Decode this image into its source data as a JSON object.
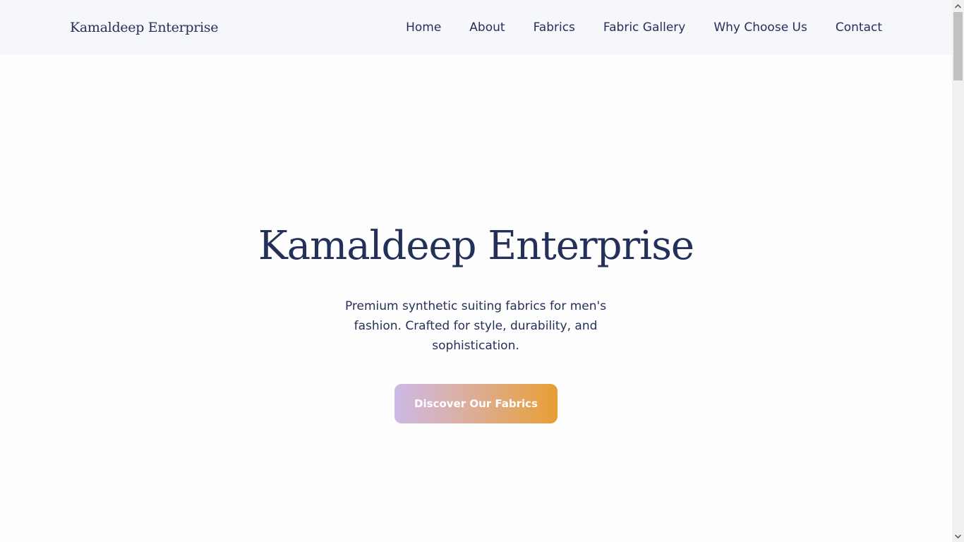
{
  "header": {
    "brand": "Kamaldeep Enterprise",
    "nav": [
      {
        "label": "Home"
      },
      {
        "label": "About"
      },
      {
        "label": "Fabrics"
      },
      {
        "label": "Fabric Gallery"
      },
      {
        "label": "Why Choose Us"
      },
      {
        "label": "Contact"
      }
    ]
  },
  "hero": {
    "title": "Kamaldeep Enterprise",
    "subtitle": "Premium synthetic suiting fabrics for men's fashion. Crafted for style, durability, and sophistication.",
    "cta_label": "Discover Our Fabrics"
  },
  "colors": {
    "text_primary": "#25305a",
    "navbar_bg": "#f6f7fb",
    "cta_gradient_start": "#cdb9e8",
    "cta_gradient_end": "#e89e34"
  },
  "scrollbar": {
    "up_icon": "chevron-up-icon",
    "down_icon": "chevron-down-icon"
  }
}
